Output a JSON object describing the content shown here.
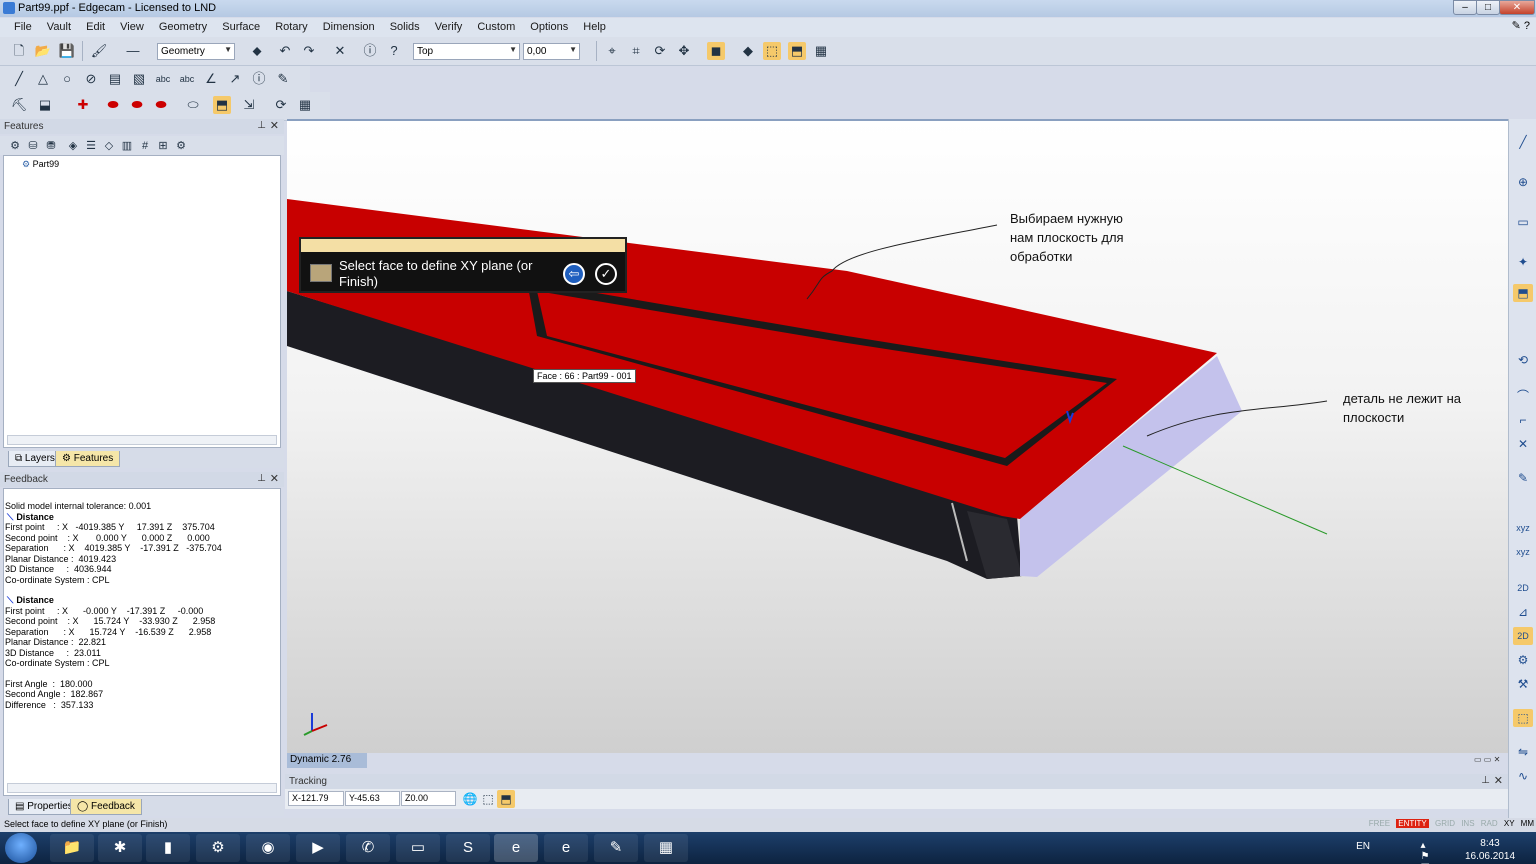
{
  "window": {
    "title": "Part99.ppf - Edgecam - Licensed to LND",
    "min": "–",
    "max": "□",
    "close": "✕"
  },
  "menu": [
    "File",
    "Vault",
    "Edit",
    "View",
    "Geometry",
    "Surface",
    "Rotary",
    "Dimension",
    "Solids",
    "Verify",
    "Custom",
    "Options",
    "Help"
  ],
  "menu_right": "✎ ?",
  "toolbar": {
    "layer_combo": "Geometry",
    "view_combo": "Top",
    "depth_combo": "0,00"
  },
  "features_panel": {
    "title": "Features",
    "tree_root": "Part99",
    "tabs": [
      "Layers",
      "Features"
    ]
  },
  "feedback_panel": {
    "title": "Feedback",
    "lines": [
      {
        "text": "Solid model internal tolerance: 0.001",
        "bold": false
      },
      {
        "text": "Distance",
        "bold": true,
        "icon": true
      },
      {
        "text": "First point     : X   -4019.385 Y     17.391 Z    375.704",
        "bold": false
      },
      {
        "text": "Second point    : X       0.000 Y      0.000 Z      0.000",
        "bold": false
      },
      {
        "text": "Separation      : X    4019.385 Y    -17.391 Z   -375.704",
        "bold": false
      },
      {
        "text": "Planar Distance :  4019.423",
        "bold": false
      },
      {
        "text": "3D Distance     :  4036.944",
        "bold": false
      },
      {
        "text": "Co-ordinate System : CPL",
        "bold": false
      },
      {
        "text": "",
        "bold": false
      },
      {
        "text": "Distance",
        "bold": true,
        "icon": true
      },
      {
        "text": "First point     : X      -0.000 Y    -17.391 Z     -0.000",
        "bold": false
      },
      {
        "text": "Second point    : X      15.724 Y    -33.930 Z      2.958",
        "bold": false
      },
      {
        "text": "Separation      : X      15.724 Y    -16.539 Z      2.958",
        "bold": false
      },
      {
        "text": "Planar Distance :  22.821",
        "bold": false
      },
      {
        "text": "3D Distance     :  23.011",
        "bold": false
      },
      {
        "text": "Co-ordinate System : CPL",
        "bold": false
      },
      {
        "text": "",
        "bold": false
      },
      {
        "text": "First Angle  :  180.000",
        "bold": false
      },
      {
        "text": "Second Angle :  182.867",
        "bold": false
      },
      {
        "text": "Difference   :  357.133",
        "bold": false
      }
    ],
    "tabs": [
      "Properties",
      "Feedback"
    ]
  },
  "viewport": {
    "prompt": "Select face to define XY plane (or Finish)",
    "face_label": "Face : 66 : Part99 - 001",
    "annotation_1": [
      "Выбираем нужную",
      "нам плоскость для",
      "обработки"
    ],
    "annotation_2": [
      "деталь не лежит на",
      "плоскости"
    ],
    "dynamic": "Dynamic 2.76"
  },
  "tracking": {
    "title": "Tracking",
    "x": "X-121.79",
    "y": "Y-45.63",
    "z": "Z0.00"
  },
  "statusbar": {
    "message": "Select face to define XY plane (or Finish)",
    "flags": [
      "FREE",
      "ENTITY",
      "GRID",
      "INS",
      "RAD",
      "XY",
      "MM"
    ],
    "active_flag": "ENTITY"
  },
  "taskbar": {
    "lang": "EN",
    "time": "8:43",
    "date": "16.06.2014"
  },
  "colors": {
    "part_top": "#c80000",
    "part_side": "#1c1c22",
    "part_end": "#c4c2ec",
    "accent": "#f5c96a"
  }
}
